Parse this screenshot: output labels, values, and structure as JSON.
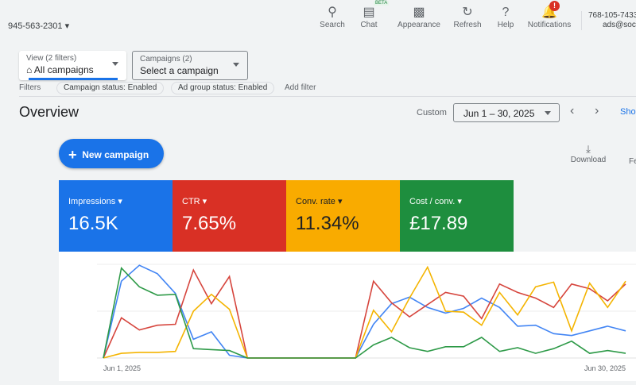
{
  "header": {
    "account_id": "945-563-2301",
    "tools": [
      {
        "label": "Search",
        "icon": "search-icon"
      },
      {
        "label": "Chat",
        "icon": "chat-icon",
        "badge": "BETA"
      },
      {
        "label": "Appearance",
        "icon": "appearance-icon"
      },
      {
        "label": "Refresh",
        "icon": "refresh-icon"
      },
      {
        "label": "Help",
        "icon": "help-icon"
      },
      {
        "label": "Notifications",
        "icon": "bell-icon",
        "badge": "!"
      }
    ],
    "user_id": "768-105-7433",
    "user_email": "ads@soci"
  },
  "view_select": {
    "label": "View (2 filters)",
    "value": "All campaigns"
  },
  "campaign_select": {
    "label": "Campaigns (2)",
    "value": "Select a campaign"
  },
  "filters": {
    "label": "Filters",
    "chips": [
      "Campaign status: Enabled",
      "Ad group status: Enabled"
    ],
    "add": "Add filter"
  },
  "overview": {
    "title": "Overview",
    "range_label": "Custom",
    "range": "Jun 1 – 30, 2025",
    "show": "Sho",
    "new_campaign": "New campaign",
    "download": "Download",
    "more": "Fe"
  },
  "metrics": [
    {
      "label": "Impressions",
      "value": "16.5K",
      "color": "#1a73e8"
    },
    {
      "label": "CTR",
      "value": "7.65%",
      "color": "#d93025"
    },
    {
      "label": "Conv. rate",
      "value": "11.34%",
      "color": "#f9ab00"
    },
    {
      "label": "Cost / conv.",
      "value": "£17.89",
      "color": "#1e8e3e"
    }
  ],
  "chart_data": {
    "type": "line",
    "x_start": "Jun 1, 2025",
    "x_end": "Jun 30, 2025",
    "ylim": [
      0,
      100
    ],
    "series": [
      {
        "name": "Impressions",
        "color": "#4285f4",
        "values": [
          0,
          82,
          99,
          90,
          69,
          20,
          28,
          3,
          0,
          0,
          0,
          0,
          0,
          0,
          0,
          36,
          58,
          65,
          54,
          48,
          53,
          64,
          54,
          34,
          35,
          26,
          24,
          29,
          34,
          29
        ]
      },
      {
        "name": "CTR",
        "color": "#d6453d",
        "values": [
          0,
          43,
          30,
          35,
          36,
          94,
          58,
          87,
          0,
          0,
          0,
          0,
          0,
          0,
          0,
          82,
          59,
          44,
          57,
          70,
          66,
          42,
          79,
          70,
          64,
          54,
          79,
          74,
          61,
          79
        ]
      },
      {
        "name": "Conv. rate",
        "color": "#f4b400",
        "values": [
          0,
          5,
          6,
          6,
          7,
          50,
          68,
          52,
          0,
          0,
          0,
          0,
          0,
          0,
          0,
          51,
          28,
          64,
          97,
          50,
          49,
          35,
          70,
          46,
          76,
          81,
          29,
          80,
          54,
          82
        ]
      },
      {
        "name": "Cost / conv.",
        "color": "#2e9a48",
        "values": [
          0,
          96,
          76,
          67,
          68,
          10,
          9,
          8,
          0,
          0,
          0,
          0,
          0,
          0,
          0,
          14,
          22,
          11,
          7,
          12,
          12,
          22,
          7,
          11,
          5,
          10,
          18,
          5,
          8,
          5
        ]
      }
    ]
  }
}
